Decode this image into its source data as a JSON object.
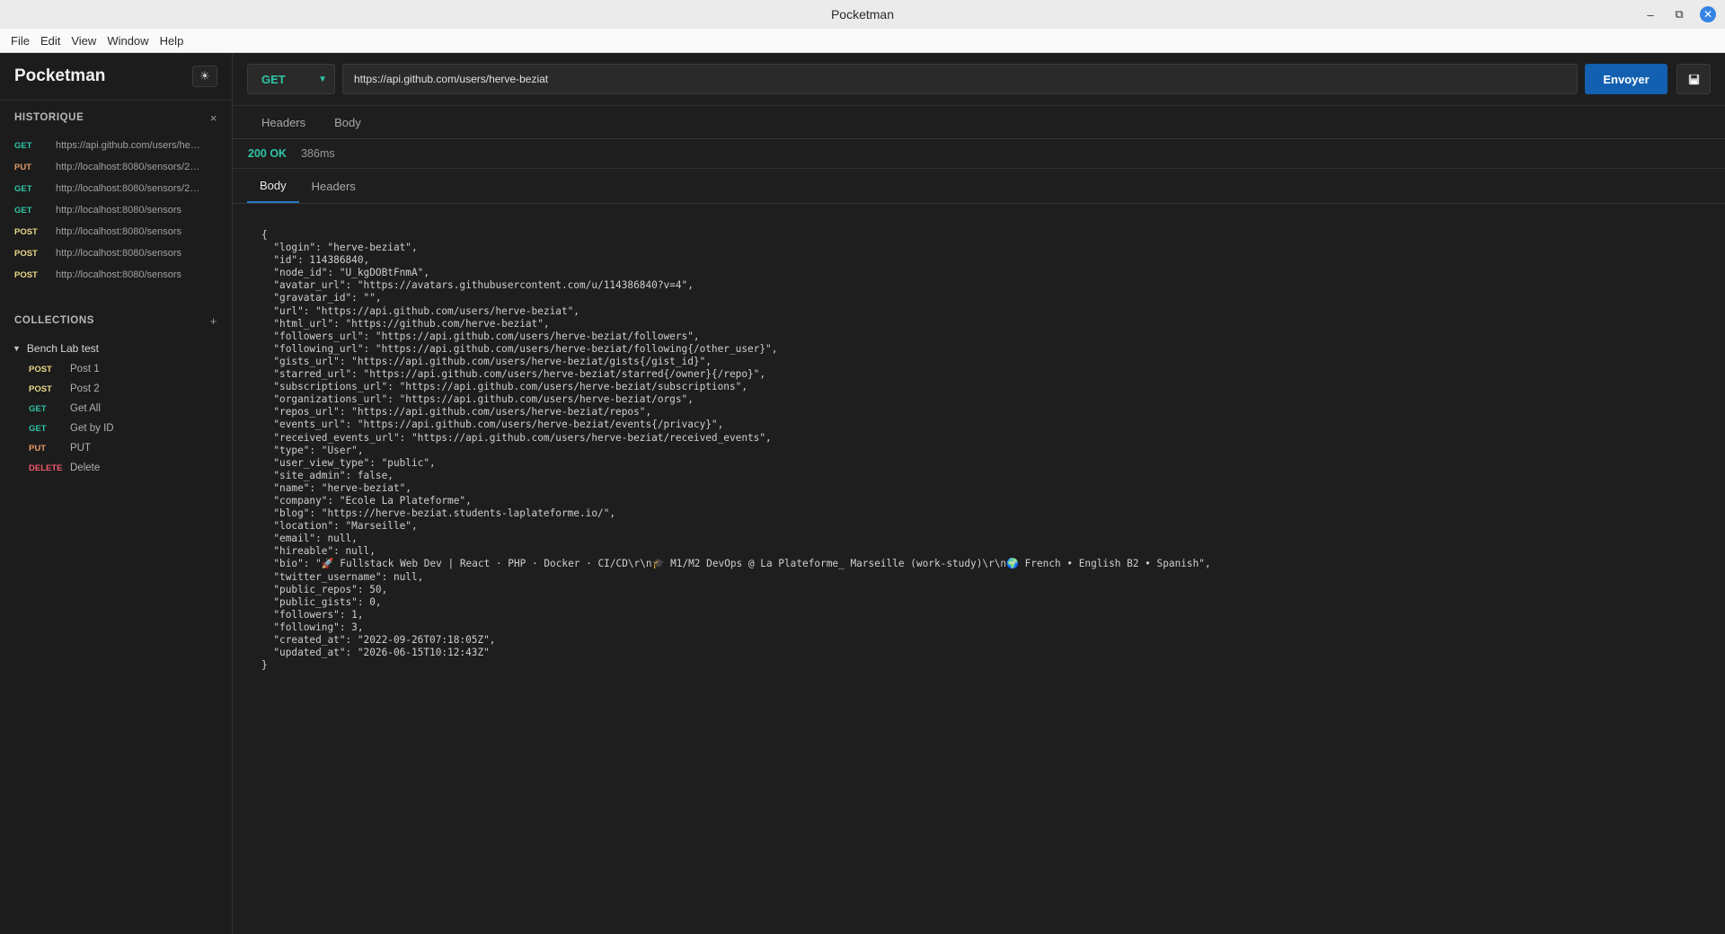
{
  "window": {
    "title": "Pocketman"
  },
  "menu": [
    "File",
    "Edit",
    "View",
    "Window",
    "Help"
  ],
  "sidebar": {
    "brand": "Pocketman",
    "theme_icon": "☀",
    "history_title": "HISTORIQUE",
    "history_clear": "×",
    "history": [
      {
        "method": "GET",
        "url": "https://api.github.com/users/her…"
      },
      {
        "method": "PUT",
        "url": "http://localhost:8080/sensors/2…"
      },
      {
        "method": "GET",
        "url": "http://localhost:8080/sensors/2…"
      },
      {
        "method": "GET",
        "url": "http://localhost:8080/sensors"
      },
      {
        "method": "POST",
        "url": "http://localhost:8080/sensors"
      },
      {
        "method": "POST",
        "url": "http://localhost:8080/sensors"
      },
      {
        "method": "POST",
        "url": "http://localhost:8080/sensors"
      }
    ],
    "collections_title": "COLLECTIONS",
    "collections_add": "+",
    "collection": {
      "name": "Bench Lab test",
      "toggle": "▼",
      "requests": [
        {
          "method": "POST",
          "label": "Post 1"
        },
        {
          "method": "POST",
          "label": "Post 2"
        },
        {
          "method": "GET",
          "label": "Get All"
        },
        {
          "method": "GET",
          "label": "Get by ID"
        },
        {
          "method": "PUT",
          "label": "PUT"
        },
        {
          "method": "DELETE",
          "label": "Delete"
        }
      ]
    }
  },
  "request": {
    "method": "GET",
    "url": "https://api.github.com/users/herve-beziat",
    "send_label": "Envoyer",
    "tabs": [
      "Headers",
      "Body"
    ]
  },
  "response": {
    "status": "200 OK",
    "time": "386ms",
    "tabs": [
      "Body",
      "Headers"
    ],
    "body": "{\n  \"login\": \"herve-beziat\",\n  \"id\": 114386840,\n  \"node_id\": \"U_kgDOBtFnmA\",\n  \"avatar_url\": \"https://avatars.githubusercontent.com/u/114386840?v=4\",\n  \"gravatar_id\": \"\",\n  \"url\": \"https://api.github.com/users/herve-beziat\",\n  \"html_url\": \"https://github.com/herve-beziat\",\n  \"followers_url\": \"https://api.github.com/users/herve-beziat/followers\",\n  \"following_url\": \"https://api.github.com/users/herve-beziat/following{/other_user}\",\n  \"gists_url\": \"https://api.github.com/users/herve-beziat/gists{/gist_id}\",\n  \"starred_url\": \"https://api.github.com/users/herve-beziat/starred{/owner}{/repo}\",\n  \"subscriptions_url\": \"https://api.github.com/users/herve-beziat/subscriptions\",\n  \"organizations_url\": \"https://api.github.com/users/herve-beziat/orgs\",\n  \"repos_url\": \"https://api.github.com/users/herve-beziat/repos\",\n  \"events_url\": \"https://api.github.com/users/herve-beziat/events{/privacy}\",\n  \"received_events_url\": \"https://api.github.com/users/herve-beziat/received_events\",\n  \"type\": \"User\",\n  \"user_view_type\": \"public\",\n  \"site_admin\": false,\n  \"name\": \"herve-beziat\",\n  \"company\": \"Ecole La Plateforme\",\n  \"blog\": \"https://herve-beziat.students-laplateforme.io/\",\n  \"location\": \"Marseille\",\n  \"email\": null,\n  \"hireable\": null,\n  \"bio\": \"🚀 Fullstack Web Dev | React · PHP · Docker · CI/CD\\r\\n🎓 M1/M2 DevOps @ La Plateforme_ Marseille (work-study)\\r\\n🌍 French • English B2 • Spanish\",\n  \"twitter_username\": null,\n  \"public_repos\": 50,\n  \"public_gists\": 0,\n  \"followers\": 1,\n  \"following\": 3,\n  \"created_at\": \"2022-09-26T07:18:05Z\",\n  \"updated_at\": \"2026-06-15T10:12:43Z\"\n}"
  },
  "colors": {
    "get": "#2ec4a5",
    "post": "#e9d889",
    "put": "#e39a66",
    "delete": "#f25a6a",
    "accent": "#1360b0"
  }
}
